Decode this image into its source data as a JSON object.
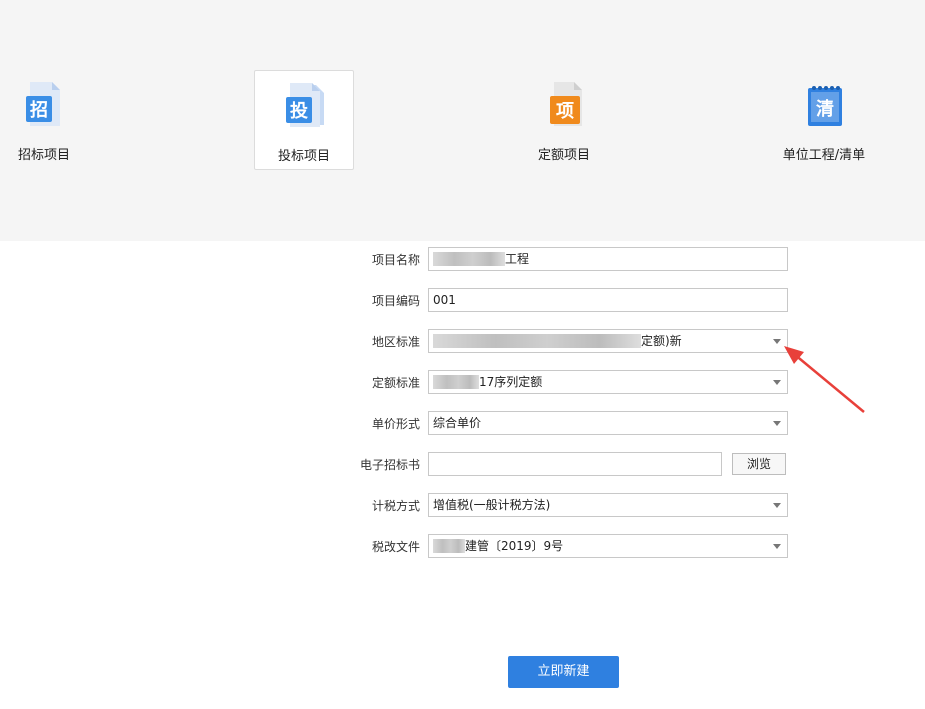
{
  "project_types": [
    {
      "label": "招标项目",
      "icon": "zhao-document-icon",
      "glyph": "招",
      "color": "#3a8ee6"
    },
    {
      "label": "投标项目",
      "icon": "tou-document-icon",
      "glyph": "投",
      "color": "#3a8ee6",
      "selected": true
    },
    {
      "label": "定额项目",
      "icon": "xiang-document-icon",
      "glyph": "项",
      "color": "#f08a1c"
    },
    {
      "label": "单位工程/清单",
      "icon": "qing-notepad-icon",
      "glyph": "清",
      "color": "#2f80e0"
    }
  ],
  "form": {
    "project_name": {
      "label": "项目名称",
      "value": "工程"
    },
    "project_code": {
      "label": "项目编码",
      "value": "001"
    },
    "region_standard": {
      "label": "地区标准",
      "value": "定额)新"
    },
    "quota_standard": {
      "label": "定额标准",
      "value": "17序列定额"
    },
    "price_form": {
      "label": "单价形式",
      "value": "综合单价"
    },
    "e_tender": {
      "label": "电子招标书",
      "value": "",
      "browse_label": "浏览"
    },
    "tax_method": {
      "label": "计税方式",
      "value": "增值税(一般计税方法)"
    },
    "tax_file": {
      "label": "税改文件",
      "value": "建管〔2019〕9号"
    }
  },
  "create_button_label": "立即新建",
  "colors": {
    "accent": "#2f80e0",
    "annotation_arrow": "#e8403a"
  }
}
